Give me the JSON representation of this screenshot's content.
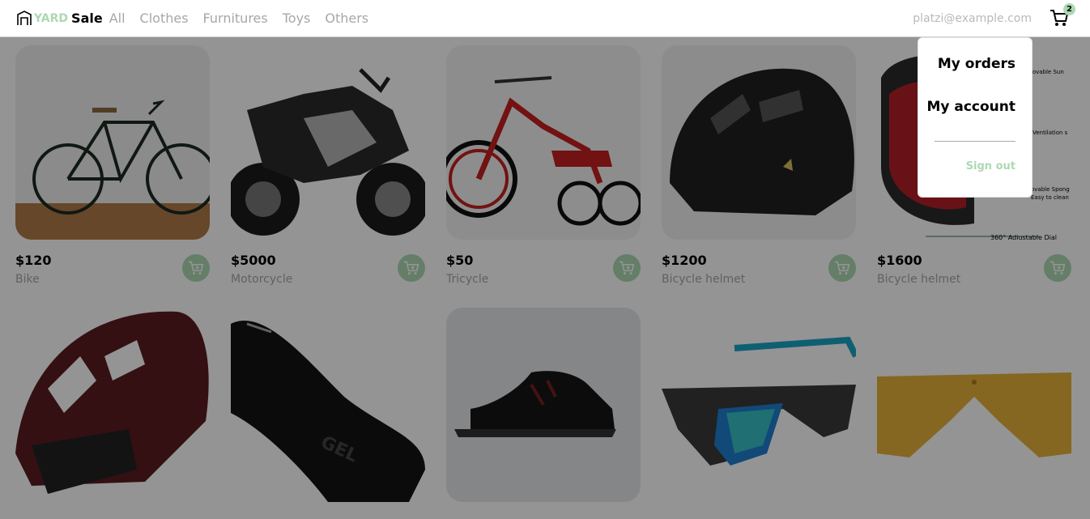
{
  "nav": {
    "logo_yard": "YARD",
    "logo_sale": "Sale",
    "links": [
      "All",
      "Clothes",
      "Furnitures",
      "Toys",
      "Others"
    ],
    "email": "platzi@example.com",
    "cart_count": "2",
    "cart_icon": "shopping-cart-icon",
    "logo_icon": "store-icon"
  },
  "menu": {
    "my_orders": "My orders",
    "my_account": "My account",
    "sign_out": "Sign out"
  },
  "products": [
    {
      "price": "$120",
      "name": "Bike",
      "icon": "bike-image"
    },
    {
      "price": "$5000",
      "name": "Motorcycle",
      "icon": "motorcycle-image"
    },
    {
      "price": "$50",
      "name": "Tricycle",
      "icon": "tricycle-image"
    },
    {
      "price": "$1200",
      "name": "Bicycle helmet",
      "icon": "helmet-image"
    },
    {
      "price": "$1600",
      "name": "Bicycle helmet",
      "icon": "helmet-diagram-image"
    },
    {
      "price": "",
      "name": "",
      "icon": "red-helmet-image"
    },
    {
      "price": "",
      "name": "",
      "icon": "saddle-image"
    },
    {
      "price": "",
      "name": "",
      "icon": "shoe-image"
    },
    {
      "price": "",
      "name": "",
      "icon": "sunglasses-image"
    },
    {
      "price": "",
      "name": "",
      "icon": "lens-image"
    }
  ],
  "colors": {
    "accent": "#acd9b2",
    "muted_text": "#a7a7a7",
    "overlay": "rgba(0,0,0,0.42)"
  }
}
